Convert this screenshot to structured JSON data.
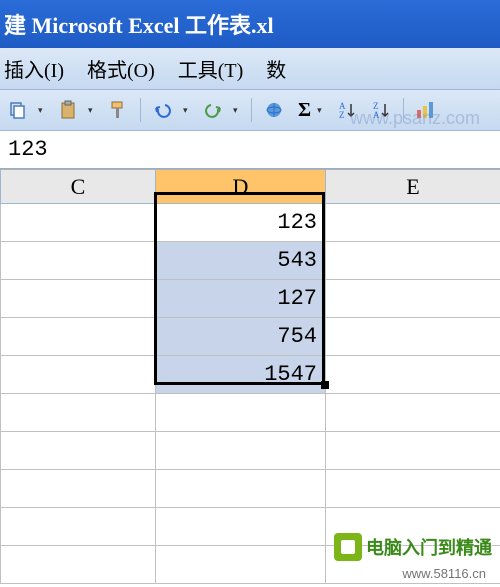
{
  "title": "建 Microsoft Excel 工作表.xl",
  "menu": {
    "insert": "插入(I)",
    "format": "格式(O)",
    "tools": "工具(T)",
    "data": "数"
  },
  "formula_bar": {
    "value": "123"
  },
  "columns": {
    "c": "C",
    "d": "D",
    "e": "E"
  },
  "chart_data": {
    "type": "table",
    "columns": [
      "C",
      "D",
      "E"
    ],
    "selected_range": "D1:D5",
    "active_cell": "D1",
    "rows": [
      {
        "C": "",
        "D": 123,
        "E": ""
      },
      {
        "C": "",
        "D": 543,
        "E": ""
      },
      {
        "C": "",
        "D": 127,
        "E": ""
      },
      {
        "C": "",
        "D": 754,
        "E": ""
      },
      {
        "C": "",
        "D": 1547,
        "E": ""
      },
      {
        "C": "",
        "D": "",
        "E": ""
      },
      {
        "C": "",
        "D": "",
        "E": ""
      },
      {
        "C": "",
        "D": "",
        "E": ""
      },
      {
        "C": "",
        "D": "",
        "E": ""
      },
      {
        "C": "",
        "D": "",
        "E": ""
      }
    ]
  },
  "watermarks": {
    "w1": "www.psanz.com",
    "w2": "电脑入门到精通",
    "w3": "www.58116.cn"
  }
}
